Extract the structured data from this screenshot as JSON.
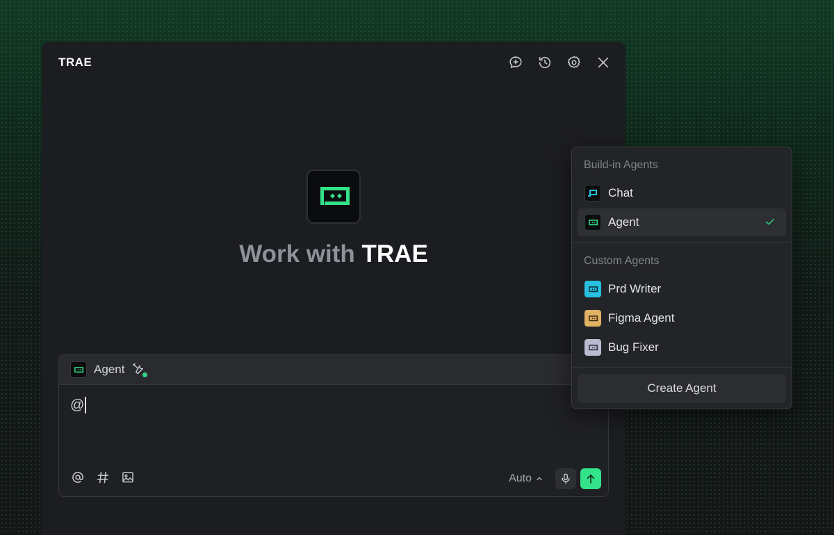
{
  "window": {
    "title": "TRAE"
  },
  "welcome": {
    "headline_prefix": "Work with",
    "headline_brand": "TRAE"
  },
  "composer": {
    "mode_label": "Agent",
    "input_value": "@",
    "model_label": "Auto"
  },
  "dropdown": {
    "builtin_title": "Build-in Agents",
    "builtin_items": [
      {
        "label": "Chat",
        "icon": "chat-agent-icon",
        "selected": false
      },
      {
        "label": "Agent",
        "icon": "agent-icon",
        "selected": true
      }
    ],
    "custom_title": "Custom Agents",
    "custom_items": [
      {
        "label": "Prd Writer",
        "icon": "prd-writer-icon",
        "color": "#27c0e0"
      },
      {
        "label": "Figma Agent",
        "icon": "figma-agent-icon",
        "color": "#e0b264"
      },
      {
        "label": "Bug Fixer",
        "icon": "bug-fixer-icon",
        "color": "#b9bcd0"
      }
    ],
    "create_label": "Create Agent"
  },
  "colors": {
    "accent": "#32e38a",
    "panel": "#1c1d20",
    "dropdown": "#232427"
  }
}
